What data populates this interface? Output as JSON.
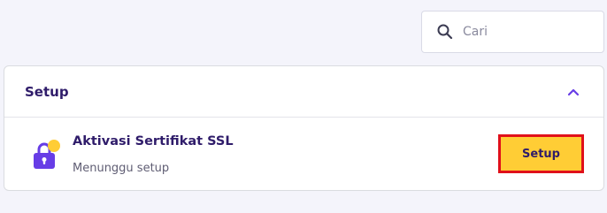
{
  "search": {
    "placeholder": "Cari",
    "icon": "search-icon"
  },
  "section": {
    "title": "Setup",
    "collapse_icon": "chevron-up-icon",
    "items": [
      {
        "title": "Aktivasi Sertifikat SSL",
        "status": "Menunggu setup",
        "icon": "lock-icon",
        "action_label": "Setup"
      }
    ]
  },
  "colors": {
    "accent": "#673de6",
    "button_bg": "#ffcd35",
    "button_border_highlight": "#e0101a",
    "status_dot": "#ffcd35",
    "text_dark": "#2f1c6a",
    "page_bg": "#f4f4fb"
  }
}
